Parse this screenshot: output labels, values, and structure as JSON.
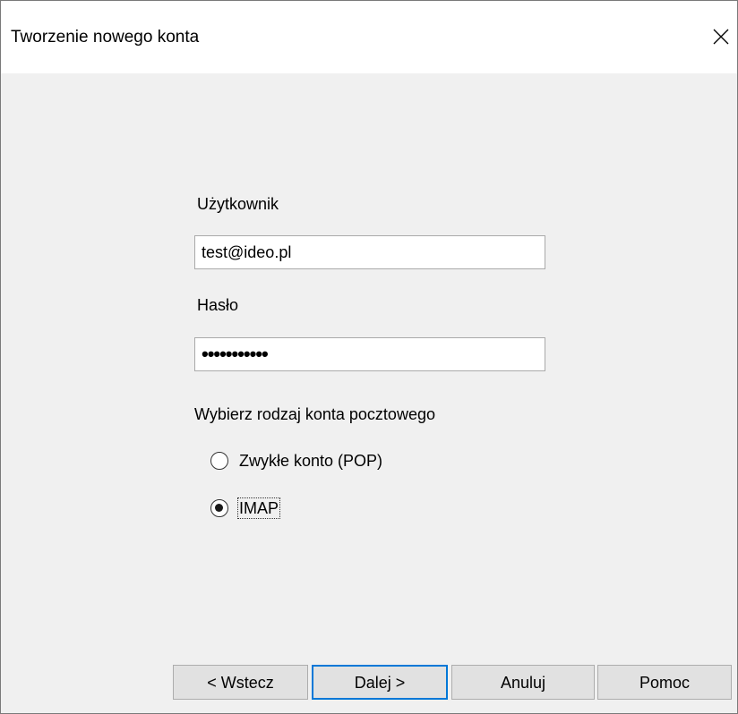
{
  "window": {
    "title": "Tworzenie nowego konta"
  },
  "form": {
    "user_label": "Użytkownik",
    "user_value": "test@ideo.pl",
    "password_label": "Hasło",
    "password_masked": "•••••••••••",
    "account_type_label": "Wybierz rodzaj konta pocztowego",
    "options": [
      {
        "label": "Zwykłe konto (POP)",
        "checked": false
      },
      {
        "label": "IMAP",
        "checked": true
      }
    ]
  },
  "buttons": {
    "back": "< Wstecz",
    "next": "Dalej >",
    "cancel": "Anuluj",
    "help": "Pomoc"
  },
  "icons": {
    "close": "close-icon"
  }
}
